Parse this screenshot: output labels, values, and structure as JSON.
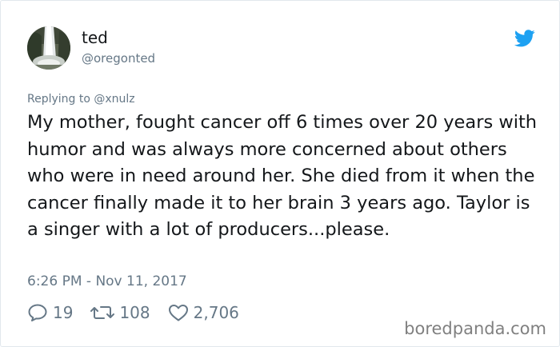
{
  "user": {
    "display_name": "ted",
    "handle": "@oregonted",
    "avatar_icon": "waterfall-avatar"
  },
  "reply": {
    "prefix": "Replying to ",
    "to": "@xnulz"
  },
  "tweet": {
    "text": "My mother, fought cancer off 6 times over 20 years with humor and was always more concerned about others who were in need around her. She died from it when the cancer finally made it to her brain 3 years ago. Taylor is a singer with a lot of producers...please.",
    "timestamp": "6:26 PM - Nov 11, 2017"
  },
  "actions": {
    "replies": "19",
    "retweets": "108",
    "likes": "2,706"
  },
  "watermark": "boredpanda.com",
  "colors": {
    "text": "#14171a",
    "secondary": "#657786",
    "twitter_blue": "#1da1f2",
    "border": "#e1e8ed"
  }
}
